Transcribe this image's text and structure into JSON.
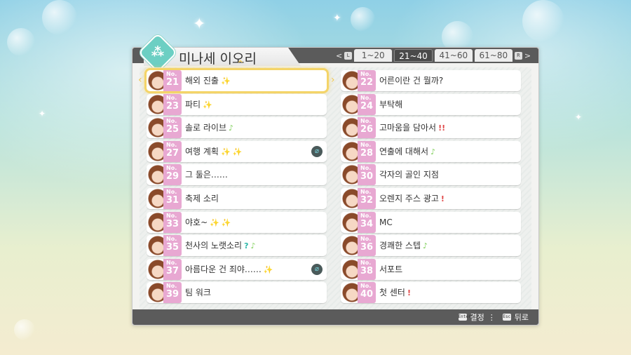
{
  "character": {
    "name": "미나세 이오리",
    "emblem_icon": "character-emblem-icon"
  },
  "tabs": [
    {
      "label": "1~20",
      "active": false
    },
    {
      "label": "21~40",
      "active": true
    },
    {
      "label": "41~60",
      "active": false
    },
    {
      "label": "61~80",
      "active": false
    }
  ],
  "tab_keys": {
    "left": "L",
    "right": "R"
  },
  "left_column": [
    {
      "no": "21",
      "title": "해외 진출",
      "badges": [
        "sparkle"
      ],
      "clip": false,
      "selected": true
    },
    {
      "no": "23",
      "title": "파티",
      "badges": [
        "sparkle"
      ],
      "clip": false,
      "selected": false
    },
    {
      "no": "25",
      "title": "솔로 라이브",
      "badges": [
        "note"
      ],
      "clip": false,
      "selected": false
    },
    {
      "no": "27",
      "title": "여행 계획",
      "badges": [
        "sparkle",
        "sparkle"
      ],
      "clip": true,
      "selected": false
    },
    {
      "no": "29",
      "title": "그 둘은……",
      "badges": [],
      "clip": false,
      "selected": false
    },
    {
      "no": "31",
      "title": "축제 소리",
      "badges": [],
      "clip": false,
      "selected": false
    },
    {
      "no": "33",
      "title": "야호~",
      "badges": [
        "sparkle",
        "sparkle"
      ],
      "clip": false,
      "selected": false
    },
    {
      "no": "35",
      "title": "천사의 노랫소리",
      "badges": [
        "question",
        "note"
      ],
      "clip": false,
      "selected": false
    },
    {
      "no": "37",
      "title": "아름다운 건 죄야……",
      "badges": [
        "sparkle"
      ],
      "clip": true,
      "selected": false
    },
    {
      "no": "39",
      "title": "팀 워크",
      "badges": [],
      "clip": false,
      "selected": false
    }
  ],
  "right_column": [
    {
      "no": "22",
      "title": "어른이란 건 뭘까?",
      "badges": [],
      "clip": false,
      "selected": false
    },
    {
      "no": "24",
      "title": "부탁해",
      "badges": [],
      "clip": false,
      "selected": false
    },
    {
      "no": "26",
      "title": "고마움을 담아서",
      "badges": [
        "exclaim2"
      ],
      "clip": false,
      "selected": false
    },
    {
      "no": "28",
      "title": "연출에 대해서",
      "badges": [
        "note"
      ],
      "clip": false,
      "selected": false
    },
    {
      "no": "30",
      "title": "각자의 골인 지점",
      "badges": [],
      "clip": false,
      "selected": false
    },
    {
      "no": "32",
      "title": "오렌지 주스 광고",
      "badges": [
        "exclaim"
      ],
      "clip": false,
      "selected": false
    },
    {
      "no": "34",
      "title": "MC",
      "badges": [],
      "clip": false,
      "selected": false
    },
    {
      "no": "36",
      "title": "경쾌한 스텝",
      "badges": [
        "note"
      ],
      "clip": false,
      "selected": false
    },
    {
      "no": "38",
      "title": "서포트",
      "badges": [],
      "clip": false,
      "selected": false
    },
    {
      "no": "40",
      "title": "첫 센터",
      "badges": [
        "exclaim"
      ],
      "clip": false,
      "selected": false
    }
  ],
  "no_label": "No.",
  "footer": {
    "confirm_key": "Enter",
    "confirm_label": "결정",
    "back_key": "Esc",
    "back_label": "뒤로"
  },
  "colors": {
    "accent": "#f4d468",
    "number_tab": "#e8a8d2",
    "frame_dark": "#5b5b5b"
  }
}
